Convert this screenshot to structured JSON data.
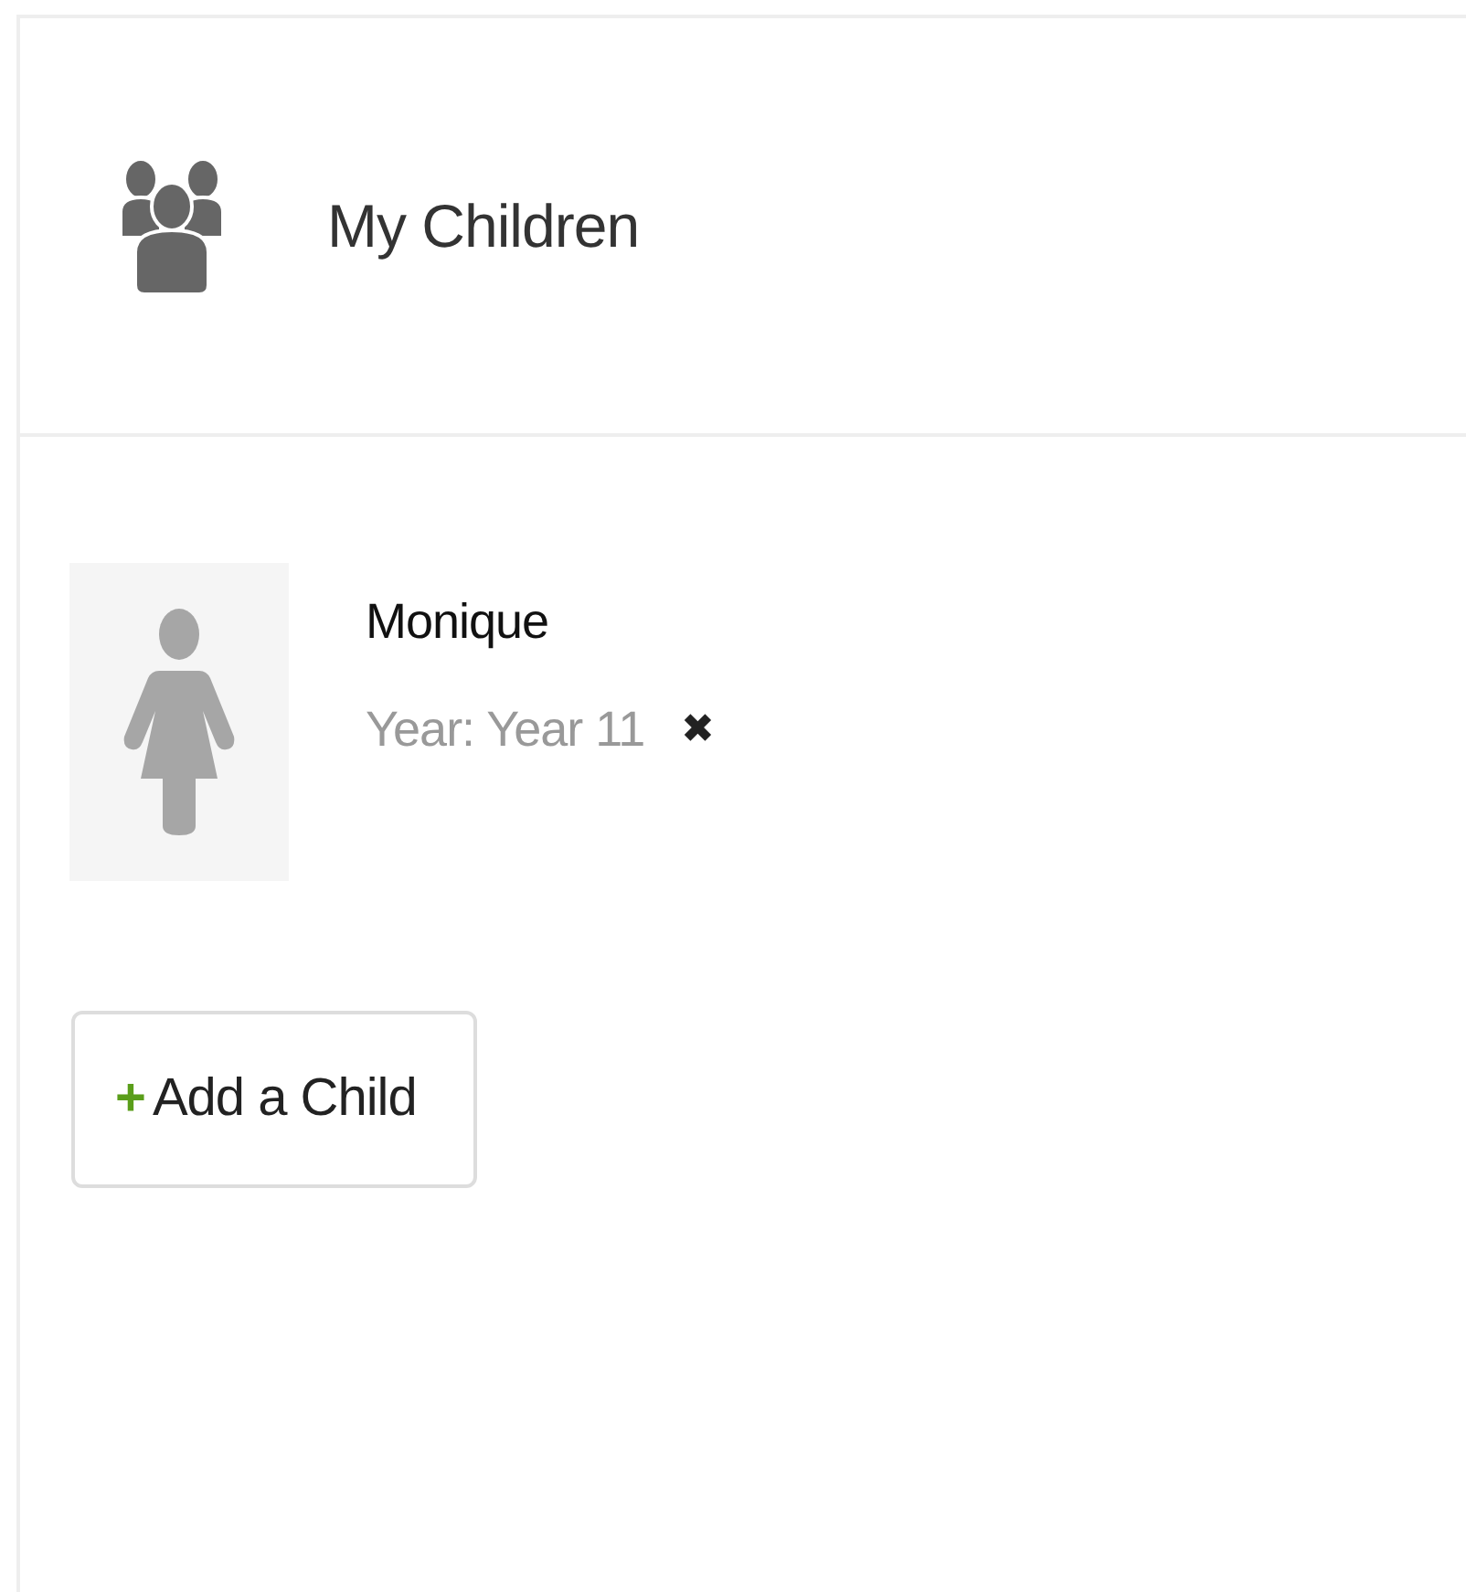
{
  "header": {
    "title": "My Children"
  },
  "children": [
    {
      "name": "Monique",
      "year": "Year: Year 11",
      "remove": "✖"
    }
  ],
  "add_button": {
    "plus": "+",
    "label": "Add a Child"
  }
}
